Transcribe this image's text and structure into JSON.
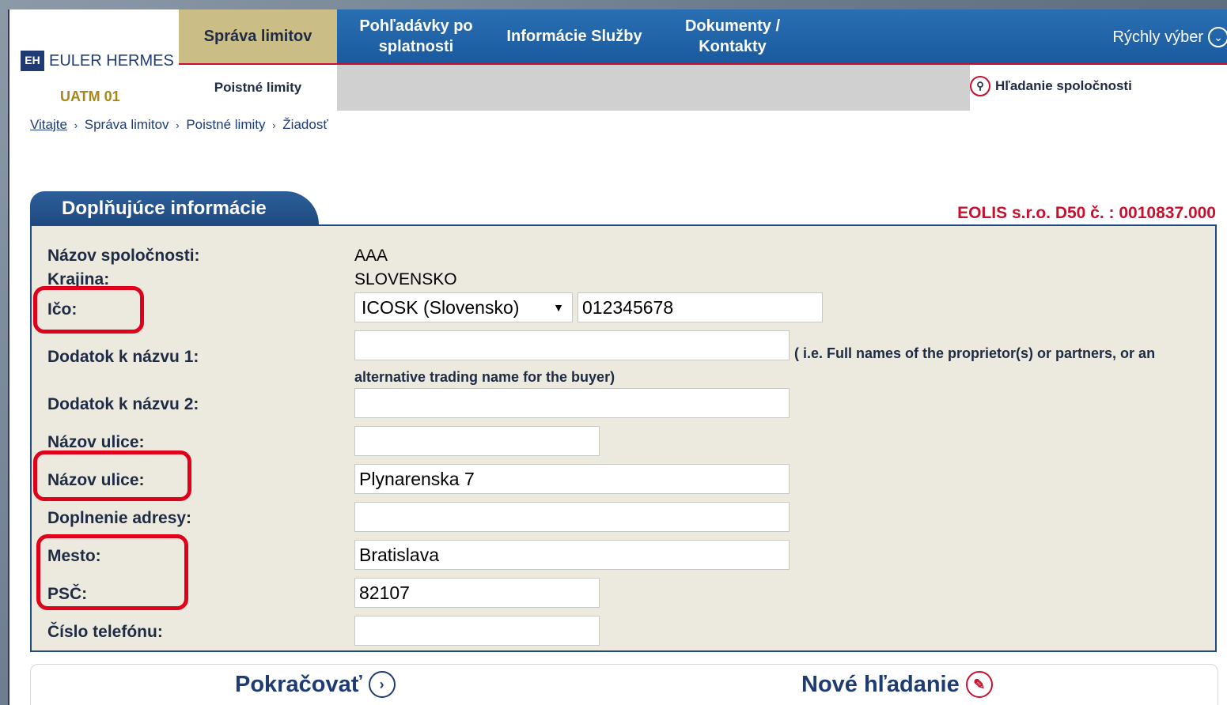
{
  "brand": {
    "logo_mark": "EH",
    "name": "EULER HERMES"
  },
  "user_code": "UATM 01",
  "nav": {
    "items": [
      {
        "label": "Správa limitov"
      },
      {
        "label": "Pohľadávky po splatnosti"
      },
      {
        "label": "Informácie Služby"
      },
      {
        "label": "Dokumenty / Kontakty"
      }
    ],
    "quick_select": "Rýchly výber"
  },
  "subnav": {
    "label": "Poistné limity",
    "company_search": "Hľadanie  spoločnosti"
  },
  "breadcrumb": {
    "home": "Vitajte",
    "items": [
      "Správa limitov",
      "Poistné limity",
      "Žiadosť"
    ]
  },
  "panel": {
    "title": "Doplňujúce informácie",
    "contract_ref": "EOLIS s.r.o. D50 č. : 0010837.000",
    "fields": {
      "company_name_label": "Názov spoločnosti:",
      "company_name_value": "AAA",
      "country_label": "Krajina:",
      "country_value": "SLOVENSKO",
      "ico_label": "Ičo:",
      "ico_type": "ICOSK (Slovensko)",
      "ico_value": "012345678",
      "name_add1_label": "Dodatok k názvu 1:",
      "name_add1_value": "",
      "name_add1_hint1": "( i.e. Full names of the proprietor(s) or partners, or an",
      "name_add1_hint2": "alternative trading name for the buyer)",
      "name_add2_label": "Dodatok k názvu 2:",
      "name_add2_value": "",
      "street1_label": "Názov ulice:",
      "street1_value": "",
      "street2_label": "Názov ulice:",
      "street2_value": "Plynarenska 7",
      "address_add_label": "Doplnenie adresy:",
      "address_add_value": "",
      "city_label": "Mesto:",
      "city_value": "Bratislava",
      "zip_label": "PSČ:",
      "zip_value": "82107",
      "phone_label": "Číslo telefónu:",
      "phone_value": ""
    }
  },
  "actions": {
    "continue": "Pokračovať",
    "new_search": "Nové  hľadanie"
  }
}
